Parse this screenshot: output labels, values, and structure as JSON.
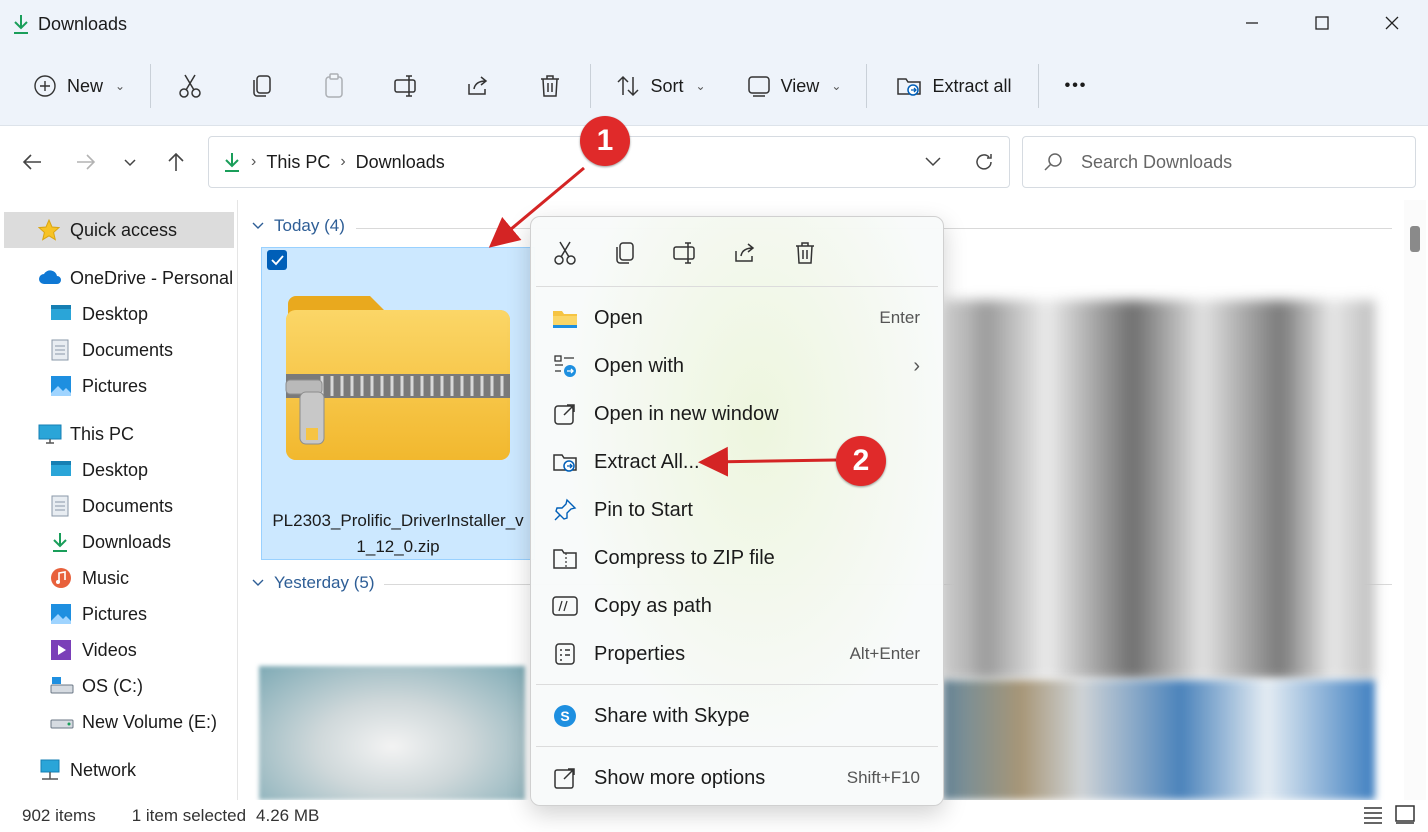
{
  "window": {
    "title": "Downloads"
  },
  "toolbar": {
    "new_label": "New",
    "sort_label": "Sort",
    "view_label": "View",
    "extract_label": "Extract all",
    "more_label": "•••"
  },
  "address": {
    "crumbs": [
      "This PC",
      "Downloads"
    ],
    "search_placeholder": "Search Downloads"
  },
  "sidebar": {
    "quick_access": "Quick access",
    "onedrive": "OneDrive - Personal",
    "onedrive_items": [
      "Desktop",
      "Documents",
      "Pictures"
    ],
    "this_pc": "This PC",
    "pc_items": [
      "Desktop",
      "Documents",
      "Downloads",
      "Music",
      "Pictures",
      "Videos",
      "OS (C:)",
      "New Volume (E:)"
    ],
    "network": "Network"
  },
  "content": {
    "group_today": "Today (4)",
    "group_yesterday": "Yesterday (5)",
    "file_name_line1": "PL2303_Prolific_DriverInstaller_v",
    "file_name_line2": "1_12_0.zip"
  },
  "status": {
    "items": "902 items",
    "selected": "1 item selected",
    "size": "4.26 MB"
  },
  "context_menu": {
    "items": [
      {
        "label": "Open",
        "shortcut": "Enter",
        "icon": "folder-icon"
      },
      {
        "label": "Open with",
        "shortcut": "",
        "icon": "open-with-icon"
      },
      {
        "label": "Open in new window",
        "shortcut": "",
        "icon": "new-window-icon"
      },
      {
        "label": "Extract All...",
        "shortcut": "",
        "icon": "extract-icon"
      },
      {
        "label": "Pin to Start",
        "shortcut": "",
        "icon": "pin-icon"
      },
      {
        "label": "Compress to ZIP file",
        "shortcut": "",
        "icon": "zip-icon"
      },
      {
        "label": "Copy as path",
        "shortcut": "",
        "icon": "copy-path-icon"
      },
      {
        "label": "Properties",
        "shortcut": "Alt+Enter",
        "icon": "properties-icon"
      },
      {
        "label": "Share with Skype",
        "shortcut": "",
        "icon": "skype-icon"
      },
      {
        "label": "Show more options",
        "shortcut": "Shift+F10",
        "icon": "more-options-icon"
      }
    ]
  },
  "annotations": {
    "step1": "1",
    "step2": "2"
  },
  "colors": {
    "accent": "#005fb8",
    "selection": "#cce8ff",
    "annotation": "#e02a2a",
    "downloads_green": "#1a9e5a"
  }
}
